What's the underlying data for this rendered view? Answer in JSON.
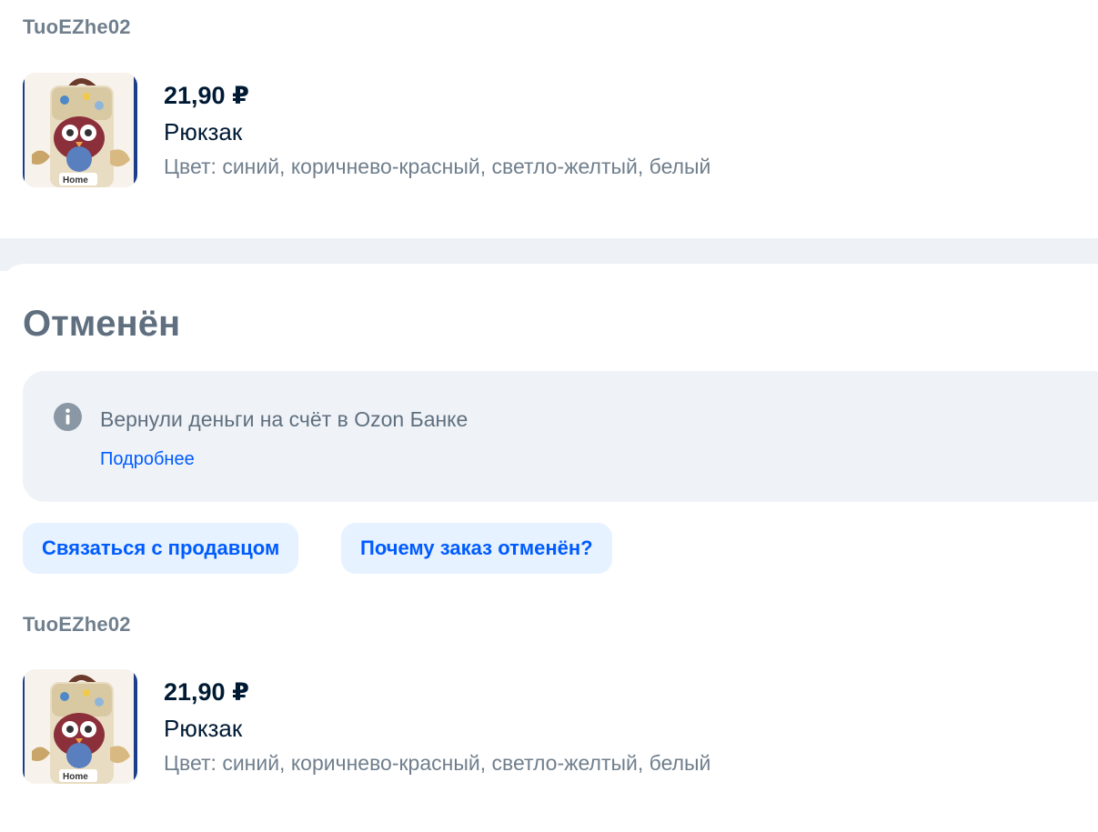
{
  "colors": {
    "text_primary": "#001a34",
    "text_secondary": "#707f8d",
    "status_gray": "#5f6f7f",
    "link_blue": "#005bff",
    "button_bg": "#e6f2ff",
    "info_bg": "#eff3f7"
  },
  "top_section": {
    "seller": "TuoEZhe02",
    "product": {
      "image_icon": "owl-backpack-image",
      "price": "21,90 ₽",
      "name": "Рюкзак",
      "color": "Цвет: синий, коричнево-красный, светло-желтый, белый"
    }
  },
  "cancelled_section": {
    "status_title": "Отменён",
    "info": {
      "icon": "info-icon",
      "text": "Вернули деньги на счёт в Ozon Банке",
      "link": "Подробнее"
    },
    "buttons": {
      "contact_seller": "Связаться с продавцом",
      "why_cancelled": "Почему заказ отменён?"
    },
    "seller": "TuoEZhe02",
    "product": {
      "image_icon": "owl-backpack-image",
      "price": "21,90 ₽",
      "name": "Рюкзак",
      "color": "Цвет: синий, коричнево-красный, светло-желтый, белый"
    }
  }
}
